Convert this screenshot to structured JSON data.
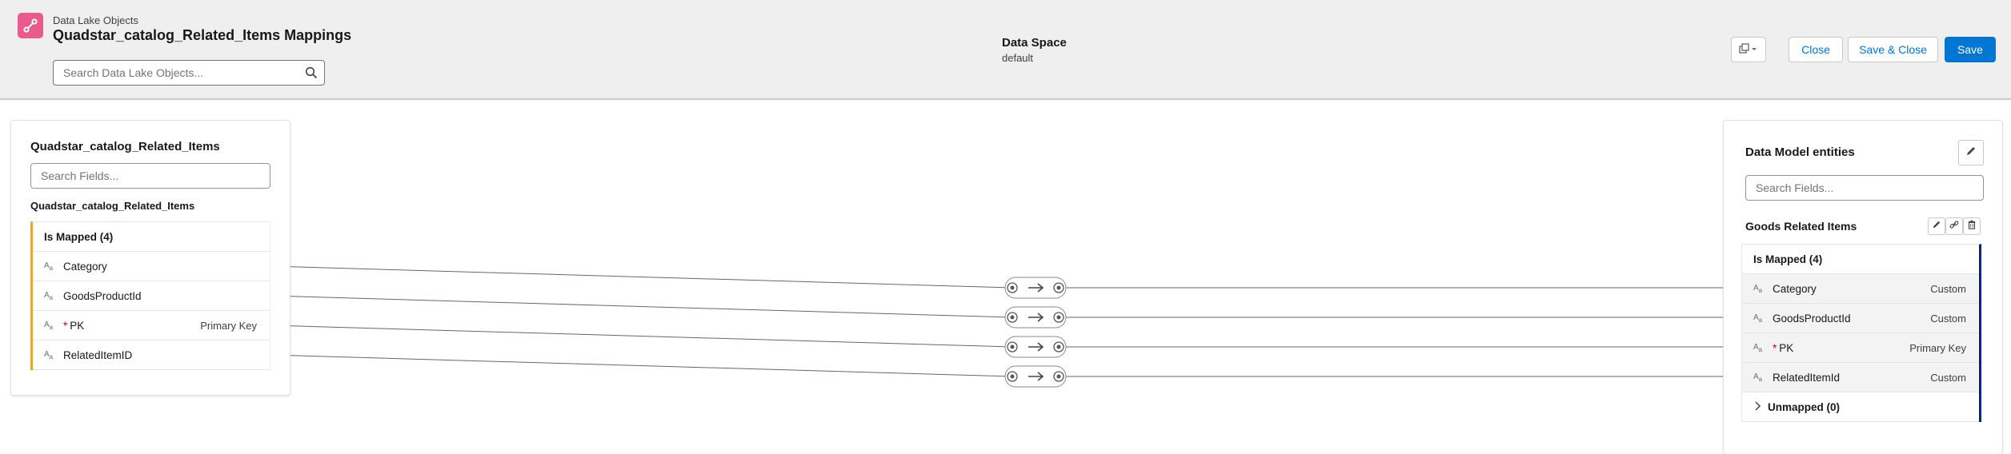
{
  "header": {
    "subtitle": "Data Lake Objects",
    "title": "Quadstar_catalog_Related_Items Mappings",
    "search_placeholder": "Search Data Lake Objects...",
    "data_space_label": "Data Space",
    "data_space_value": "default",
    "buttons": {
      "close": "Close",
      "save_close": "Save & Close",
      "save": "Save"
    },
    "accent_color": "#0176d3",
    "logo_color": "#ea5a8c"
  },
  "source": {
    "title": "Quadstar_catalog_Related_Items",
    "search_placeholder": "Search Fields...",
    "object_name": "Quadstar_catalog_Related_Items",
    "mapped_header": "Is Mapped (4)",
    "fields": [
      {
        "type": "A",
        "name": "Category",
        "required": "",
        "meta": ""
      },
      {
        "type": "A",
        "name": "GoodsProductId",
        "required": "",
        "meta": ""
      },
      {
        "type": "A",
        "name": "PK",
        "required": "*",
        "meta": "Primary Key"
      },
      {
        "type": "A",
        "name": "RelatedItemID",
        "required": "",
        "meta": ""
      }
    ]
  },
  "target": {
    "title": "Data Model entities",
    "search_placeholder": "Search Fields...",
    "entity_name": "Goods Related Items",
    "mapped_header": "Is Mapped (4)",
    "unmapped_header": "Unmapped (0)",
    "fields": [
      {
        "type": "A",
        "name": "Category",
        "required": "",
        "meta": "Custom"
      },
      {
        "type": "A",
        "name": "GoodsProductId",
        "required": "",
        "meta": "Custom"
      },
      {
        "type": "A",
        "name": "PK",
        "required": "*",
        "meta": "Primary Key"
      },
      {
        "type": "A",
        "name": "RelatedItemId",
        "required": "",
        "meta": "Custom"
      }
    ]
  },
  "icons": {
    "logo": "mapping-icon",
    "search": "search-icon",
    "actions_menu": "actions-dropdown-icon",
    "edit": "pencil-icon",
    "link": "link-icon",
    "delete": "trash-icon",
    "chevron": "chevron-right-icon",
    "arrow": "arrow-right-icon"
  }
}
